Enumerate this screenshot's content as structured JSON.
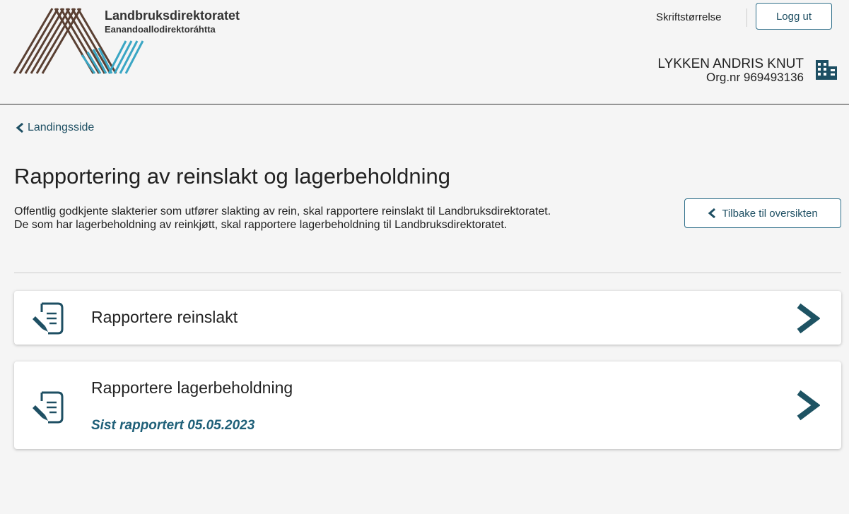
{
  "header": {
    "logo_name": "Landbruksdirektoratet",
    "logo_sub": "Eanandoallodirektoráhtta",
    "font_size_link": "Skriftstørrelse",
    "logout_label": "Logg ut",
    "user_name": "LYKKEN ANDRIS KNUT",
    "org_nr": "Org.nr 969493136",
    "org_icon": "building-icon"
  },
  "nav": {
    "back_link": "Landingsside"
  },
  "main": {
    "title": "Rapportering av reinslakt og lagerbeholdning",
    "intro": "Offentlig godkjente slakterier som utfører slakting av rein, skal rapportere reinslakt til Landbruksdirektoratet. De som har lagerbeholdning av reinkjøtt, skal rapportere lagerbeholdning til Landbruksdirektoratet.",
    "back_button": "Tilbake til oversikten"
  },
  "cards": [
    {
      "title": "Rapportere reinslakt",
      "icon": "document-edit-icon"
    },
    {
      "title": "Rapportere lagerbeholdning",
      "subtitle": "Sist rapportert 05.05.2023",
      "icon": "document-edit-icon"
    }
  ],
  "colors": {
    "accent": "#1e4f63",
    "chevron": "#1e5363",
    "logo_brown": "#5a4033",
    "logo_teal": "#3aa6c4",
    "background": "#f5f5f5"
  }
}
